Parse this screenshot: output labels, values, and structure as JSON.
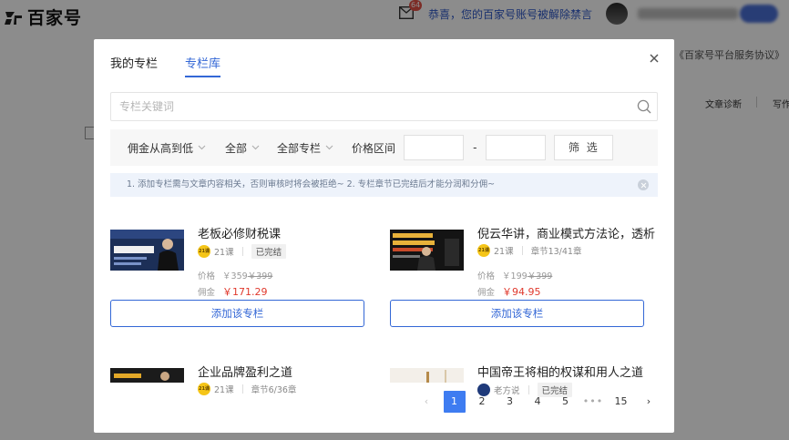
{
  "header": {
    "logo_text": "百家号",
    "mail_count": "64",
    "notice": "恭喜，您的百家号账号被解除禁言"
  },
  "background": {
    "agreement_text": "《百家号平台服务协议》",
    "article_diagnosis": "文章诊断",
    "write": "写作"
  },
  "modal": {
    "tabs": [
      {
        "label": "我的专栏",
        "active": false
      },
      {
        "label": "专栏库",
        "active": true
      }
    ],
    "search_placeholder": "专栏关键词",
    "filters": {
      "sort": "佣金从高到低",
      "category": "全部",
      "column_type": "全部专栏",
      "price_range_label": "价格区间",
      "price_min": "",
      "price_max": "",
      "range_separator": "-",
      "filter_button": "筛 选"
    },
    "tip": "1. 添加专栏需与文章内容相关，否则审核时将会被拒绝~   2. 专栏章节已完结后才能分润和分佣~",
    "price_label": "价格",
    "commission_label": "佣金",
    "add_button": "添加该专栏",
    "cards": [
      {
        "title": "老板必修财税课",
        "brand": "21课",
        "lessons": "21课",
        "status": "已完结",
        "price": "￥359",
        "original_price": "￥399",
        "commission": "￥171.29"
      },
      {
        "title": "倪云华讲，商业模式方法论，透析",
        "brand": "21课",
        "lessons": "21课",
        "status": "章节13/41章",
        "price": "￥199",
        "original_price": "￥399",
        "commission": "￥94.95"
      },
      {
        "title": "企业品牌盈利之道",
        "brand": "21课",
        "lessons": "21课",
        "status": "章节6/36章"
      },
      {
        "title": "中国帝王将相的权谋和用人之道",
        "brand": "",
        "lessons": "老方说",
        "status": "已完结"
      }
    ],
    "pagination": {
      "prev": "‹",
      "pages": [
        "1",
        "2",
        "3",
        "4",
        "5"
      ],
      "ellipsis": "•••",
      "last": "15",
      "next": "›",
      "current": "1"
    }
  },
  "colors": {
    "accent": "#3367d6",
    "commission": "#e0392d",
    "overlay": "rgba(0,0,0,0.45)"
  }
}
